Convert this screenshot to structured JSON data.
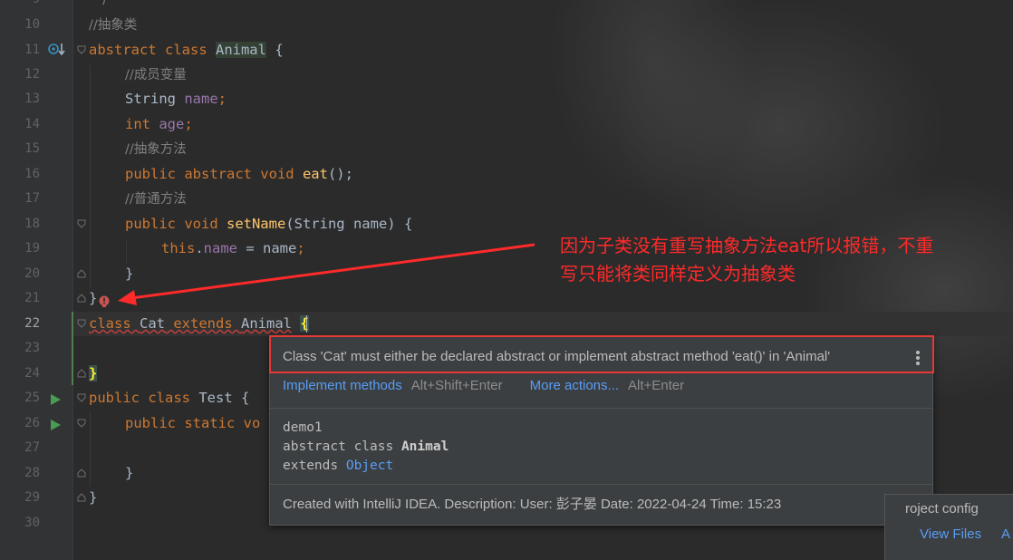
{
  "gutter": {
    "line_numbers": [
      "10",
      "11",
      "12",
      "13",
      "14",
      "15",
      "16",
      "17",
      "18",
      "19",
      "20",
      "21",
      "22",
      "23",
      "24",
      "25",
      "26",
      "27",
      "28",
      "29",
      "30"
    ],
    "partial_top_line": "9"
  },
  "code": {
    "partial_top": "*/",
    "l10": "//抽象类",
    "l11_kw": "abstract class ",
    "l11_cls": "Animal",
    "l11_rest": " {",
    "l12": "//成员变量",
    "l13_type": "String ",
    "l13_name": "name",
    "l13_semi": ";",
    "l14_type": "int ",
    "l14_name": "age",
    "l14_semi": ";",
    "l15": "//抽象方法",
    "l16_kw": "public abstract void ",
    "l16_fn": "eat",
    "l16_rest": "();",
    "l17": "//普通方法",
    "l18_kw": "public void ",
    "l18_fn": "setName",
    "l18_rest": "(String name) {",
    "l19_kw": "this",
    "l19_dot": ".",
    "l19_fld": "name",
    "l19_rest": " = name",
    "l19_semi": ";",
    "l20": "}",
    "l21": "}",
    "l22_kw": "class ",
    "l22_cls": "Cat",
    "l22_ext": " extends ",
    "l22_parent": "Animal",
    "l22_brace": "{",
    "l24": "}",
    "l25_kw": "public class ",
    "l25_cls": "Test {",
    "l26_kw": "public static vo",
    "l28": "}",
    "l29": "}"
  },
  "popup": {
    "message": "Class 'Cat' must either be declared abstract or implement abstract method 'eat()' in 'Animal'",
    "action1": "Implement methods",
    "action1_shortcut": "Alt+Shift+Enter",
    "action2": "More actions...",
    "action2_shortcut": "Alt+Enter",
    "doc_package": "demo1",
    "doc_decl_kw": "abstract class ",
    "doc_decl_name": "Animal",
    "doc_extends": "extends ",
    "doc_extends_link": "Object",
    "footer": "Created with IntelliJ IDEA. Description: User: 彭子晏 Date: 2022-04-24 Time: 15:23"
  },
  "annotation": {
    "line1": "因为子类没有重写抽象方法eat所以报错，不重",
    "line2": "写只能将类同样定义为抽象类",
    "color": "#ff2a2a"
  },
  "notification": {
    "text": "roject config",
    "link1": "View Files",
    "link2": "A"
  },
  "colors": {
    "background": "#2b2b2b",
    "keyword": "#cc7832",
    "comment": "#808080",
    "field": "#9876aa",
    "method": "#ffc66d",
    "link": "#589df6"
  }
}
